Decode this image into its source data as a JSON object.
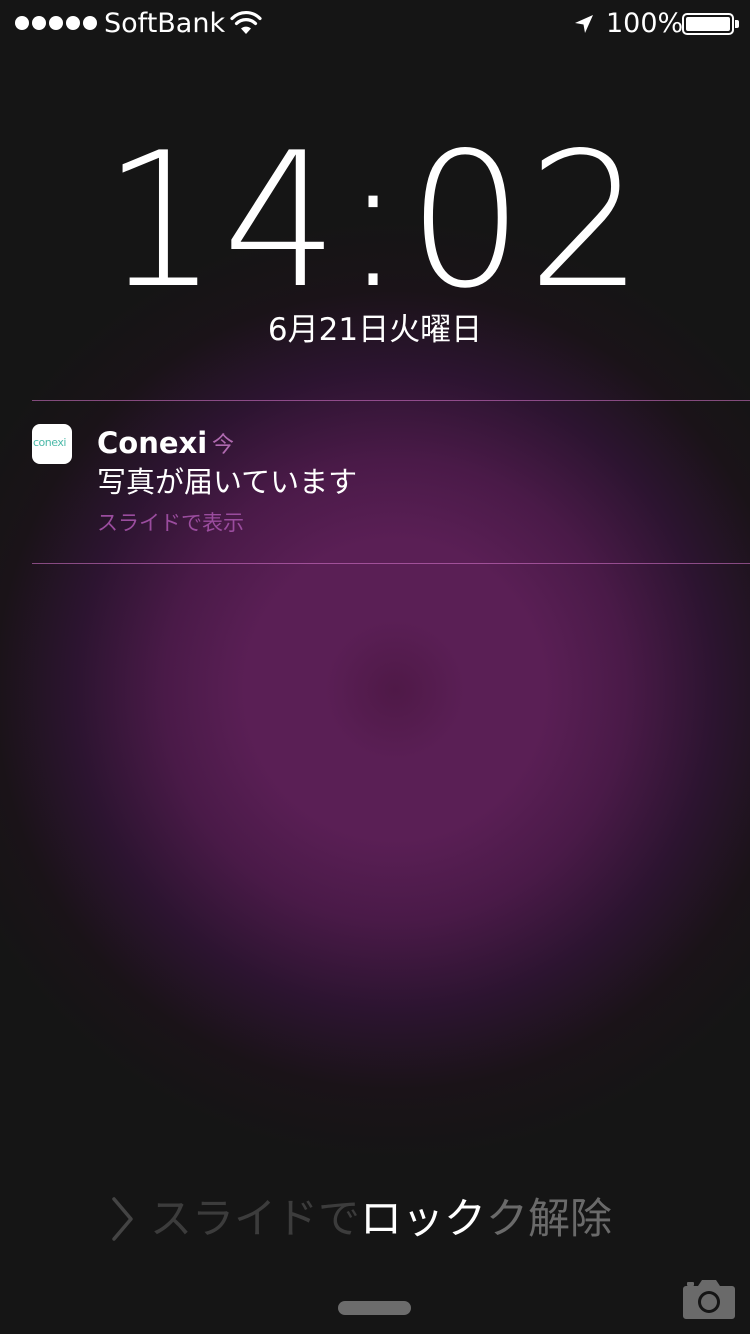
{
  "status_bar": {
    "signal_dots": 5,
    "carrier": "SoftBank",
    "wifi_icon": "wifi-icon",
    "location_icon": "location-arrow-icon",
    "battery_percent": "100%",
    "battery_level": 1.0
  },
  "lock_screen": {
    "time": "14:02",
    "date": "6月21日火曜日"
  },
  "notification": {
    "app_name": "Conexi",
    "app_icon_text": "conexi",
    "time": "今",
    "message": "写真が届いています",
    "action_hint": "スライドで表示"
  },
  "unlock": {
    "chevron_icon": "chevron-right-icon",
    "text_dim": "スライドで",
    "text_bright": "ロック",
    "text_fade": "ク解除"
  },
  "camera_icon": "camera-icon",
  "colors": {
    "background": "#151515",
    "glow": "#5a1f55",
    "notification_accent": "#b06ab0",
    "logo_teal": "#4bb9a8"
  }
}
